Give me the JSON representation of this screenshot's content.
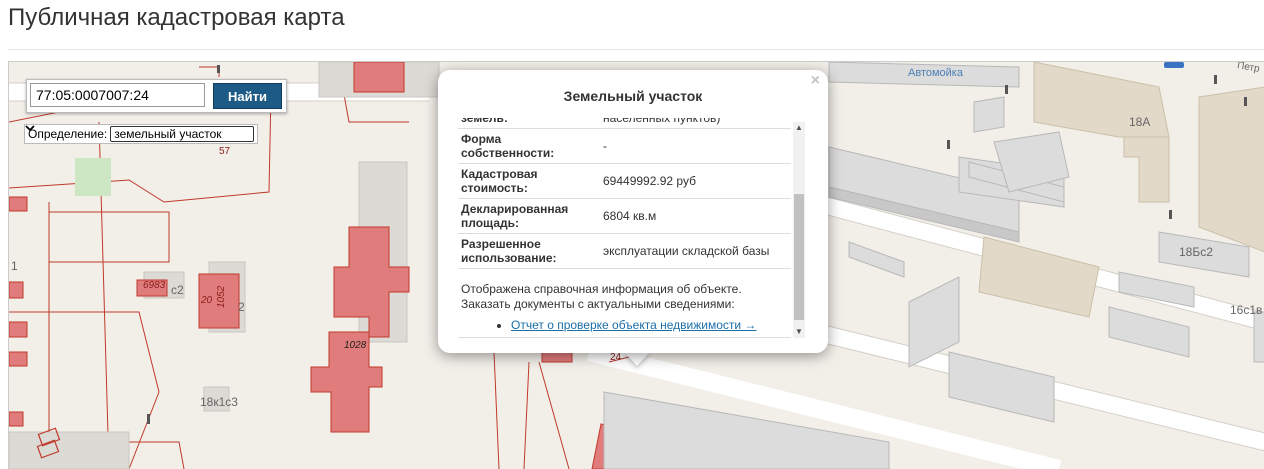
{
  "page": {
    "title": "Публичная кадастровая карта"
  },
  "search": {
    "value": "77:05:0007007:24",
    "button_label": "Найти"
  },
  "definition": {
    "label": "Определение:",
    "selected": "земельный участок",
    "chevron": "chevron-down-icon"
  },
  "map": {
    "labels": {
      "parcel_57": "57",
      "parcel_6983": "6983",
      "parcel_20": "20",
      "parcel_1052": "1052",
      "parcel_1028": "1028",
      "parcel_24": "24",
      "c2": "c2",
      "n2": "2",
      "n1": "1",
      "bld_18k1s3": "18к1с3",
      "bld_18A": "18А",
      "bld_18Bs2": "18Бс2",
      "bld_16s1v": "16с1в",
      "street_avtomoyka": "Автомойка",
      "street_petr": "Петр"
    },
    "colors": {
      "parcel_fill": "#e07c7c",
      "parcel_border": "#c0392b",
      "building": "#dcdcdc",
      "building_beige": "#e3d9c9"
    }
  },
  "popup": {
    "title": "Земельный участок",
    "close": "×",
    "rows": [
      {
        "name": "земель:",
        "value": "населенных пунктов)"
      },
      {
        "name": "Форма собственности:",
        "value": "-"
      },
      {
        "name": "Кадастровая стоимость:",
        "value": "69449992.92 руб"
      },
      {
        "name": "Декларированная площадь:",
        "value": "6804 кв.м"
      },
      {
        "name": "Разрешенное использование:",
        "value": "эксплуатации складской базы"
      }
    ],
    "info_line1": "Отображена справочная информация об объекте.",
    "info_line2": "Заказать документы с актуальными сведениями:",
    "link": "Отчет о проверке объекта недвижимости →"
  }
}
